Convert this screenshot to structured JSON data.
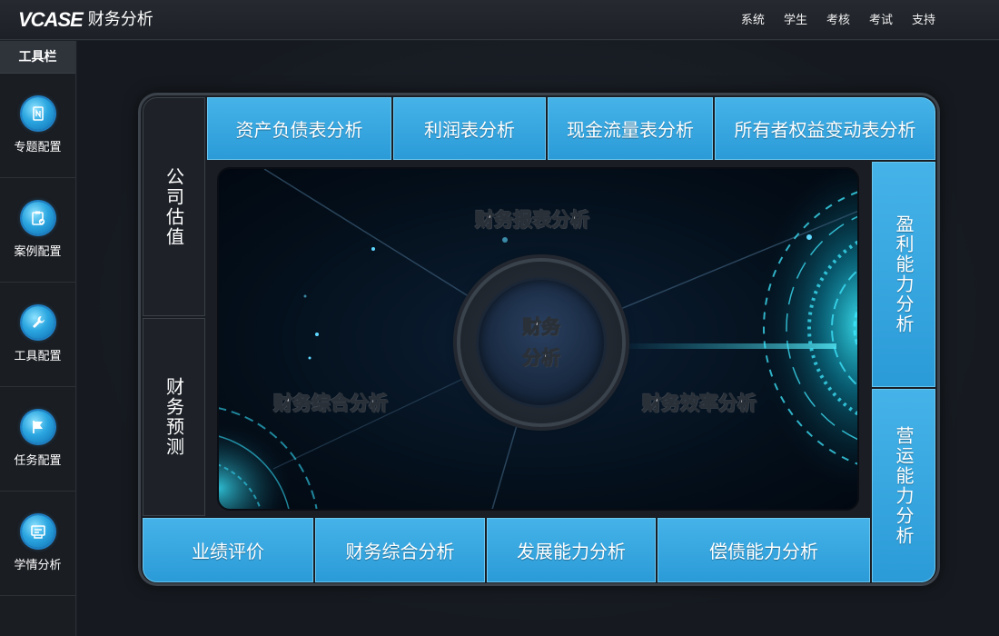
{
  "header": {
    "logo_text": "VCASE",
    "app_title": "财务分析",
    "nav": [
      "系统",
      "学生",
      "考核",
      "考试",
      "支持"
    ]
  },
  "sidebar": {
    "title": "工具栏",
    "items": [
      {
        "label": "专题配置",
        "icon": "topic-config-icon"
      },
      {
        "label": "案例配置",
        "icon": "case-config-icon"
      },
      {
        "label": "工具配置",
        "icon": "wrench-icon"
      },
      {
        "label": "任务配置",
        "icon": "flag-icon"
      },
      {
        "label": "学情分析",
        "icon": "report-icon"
      }
    ]
  },
  "tiles": {
    "top": [
      "资产负债表分析",
      "利润表分析",
      "现金流量表分析",
      "所有者权益变动表分析"
    ],
    "left": [
      "公司估值",
      "财务预测"
    ],
    "right": [
      "盈利能力分析",
      "营运能力分析"
    ],
    "bottom": [
      "业绩评价",
      "财务综合分析",
      "发展能力分析",
      "偿债能力分析"
    ]
  },
  "center": {
    "hub_line1": "财务",
    "hub_line2": "分析",
    "top_label": "财务报表分析",
    "left_label": "财务综合分析",
    "right_label": "财务效率分析"
  },
  "colors": {
    "tile_blue": "#3aa9e0",
    "logo_red": "#e23b3b",
    "background": "#1b1f26"
  }
}
